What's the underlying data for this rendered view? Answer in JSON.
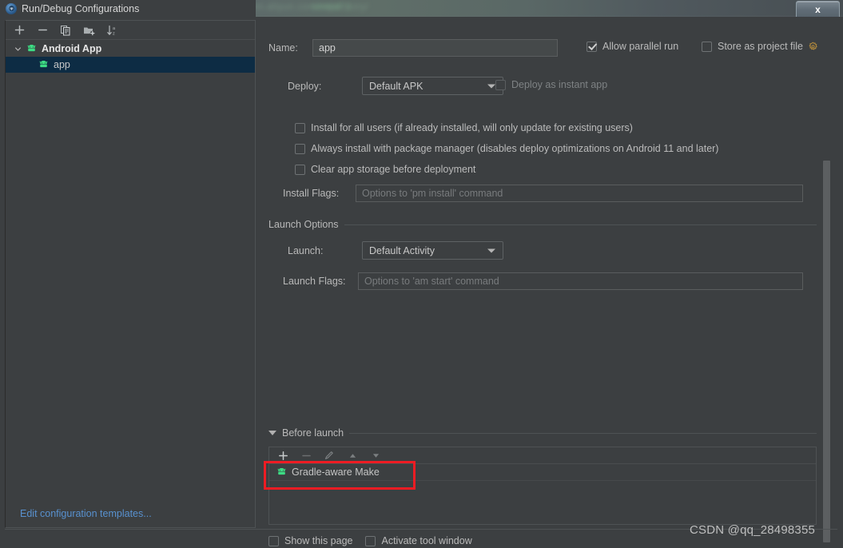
{
  "window": {
    "title": "Run/Debug Configurations",
    "app_icon": "android-studio-icon",
    "close_label": "x"
  },
  "background": {
    "blur_text_1": "ame( url \"https://maven.aliyun.com/repository/",
    "blur_text_2": "central\" )"
  },
  "sidebar": {
    "toolbar": [
      {
        "name": "add-configuration-button",
        "glyph": "+"
      },
      {
        "name": "remove-configuration-button",
        "glyph": "−"
      },
      {
        "name": "copy-configuration-button",
        "glyph": "copy-icon"
      },
      {
        "name": "new-folder-button",
        "glyph": "folder-add-icon"
      },
      {
        "name": "sort-configurations-button",
        "glyph": "sort-az-icon"
      }
    ],
    "tree": [
      {
        "label": "Android App",
        "icon": "android-icon",
        "type": "group",
        "expanded": true,
        "selected": false
      },
      {
        "label": "app",
        "icon": "android-icon",
        "type": "child",
        "expanded": false,
        "selected": true
      }
    ],
    "edit_templates_link": "Edit configuration templates..."
  },
  "main": {
    "name_label": "Name:",
    "name_value": "app",
    "allow_parallel_run": {
      "label": "Allow parallel run",
      "checked": true
    },
    "store_as_project_file": {
      "label": "Store as project file",
      "checked": false,
      "gear_icon": "gear-icon"
    },
    "deploy_label": "Deploy:",
    "deploy_value": "Default APK",
    "deploy_as_instant_app": {
      "label": "Deploy as instant app",
      "checked": false,
      "disabled": true
    },
    "checkboxes": [
      {
        "label": "Install for all users (if already installed, will only update for existing users)",
        "checked": false,
        "name": "install-for-all-users-checkbox"
      },
      {
        "label": "Always install with package manager (disables deploy optimizations on Android 11 and later)",
        "checked": false,
        "name": "always-install-with-package-manager-checkbox"
      },
      {
        "label": "Clear app storage before deployment",
        "checked": false,
        "name": "clear-app-storage-checkbox"
      }
    ],
    "install_flags_label": "Install Flags:",
    "install_flags_placeholder": "Options to 'pm install' command",
    "install_flags_value": "",
    "launch_options_section": "Launch Options",
    "launch_label": "Launch:",
    "launch_value": "Default Activity",
    "launch_flags_label": "Launch Flags:",
    "launch_flags_placeholder": "Options to 'am start' command",
    "launch_flags_value": "",
    "before_launch": {
      "section_label": "Before launch",
      "expanded": true,
      "toolbar": [
        {
          "name": "add-task-button",
          "glyph": "+",
          "enabled": true
        },
        {
          "name": "remove-task-button",
          "glyph": "−",
          "enabled": false
        },
        {
          "name": "edit-task-button",
          "glyph": "pencil-icon",
          "enabled": false
        },
        {
          "name": "move-up-button",
          "glyph": "arrow-up-icon",
          "enabled": false
        },
        {
          "name": "move-down-button",
          "glyph": "arrow-down-icon",
          "enabled": false
        }
      ],
      "items": [
        {
          "label": "Gradle-aware Make",
          "icon": "android-icon",
          "highlighted": true
        }
      ]
    },
    "show_this_page": {
      "label": "Show this page",
      "checked": false
    },
    "activate_tool_window": {
      "label": "Activate tool window",
      "checked": false
    }
  },
  "overlay": {
    "watermark": "CSDN @qq_28498355",
    "highlight_color": "#ee1c23"
  },
  "colors": {
    "window_bg": "#3c3f41",
    "selection_bg": "#0d2c44",
    "link": "#5891cf",
    "android_green": "#3ddc84",
    "text": "#bbbbbb"
  }
}
